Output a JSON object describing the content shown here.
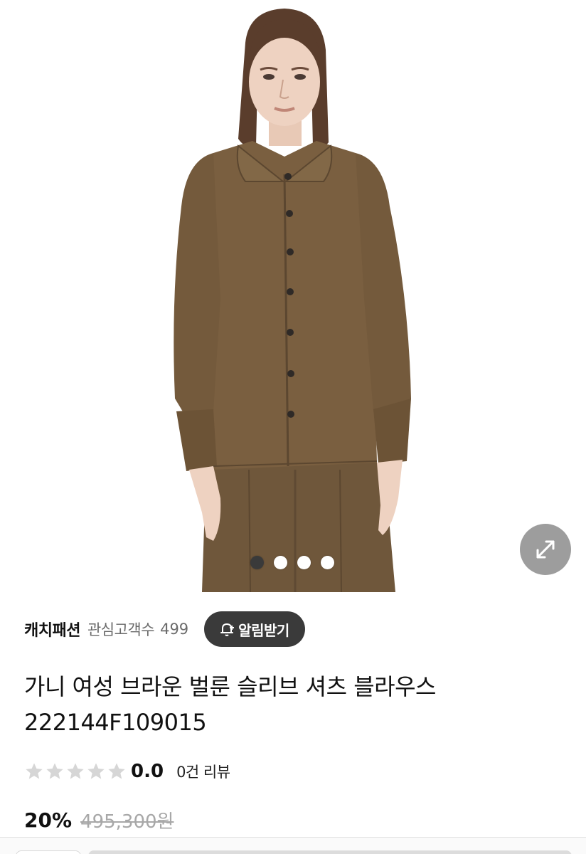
{
  "gallery": {
    "image_alt": "브라운 벌룬 슬리브 셔츠를 입은 모델",
    "current_index": 1,
    "total_images": 4,
    "zoom_icon": "expand-arrows-icon"
  },
  "seller": {
    "name": "캐치패션",
    "follower_label": "관심고객수",
    "follower_count": "499",
    "alert_button_label": "알림받기",
    "alert_icon": "bell-plus-icon"
  },
  "product": {
    "title": "가니 여성 브라운 벌룬 슬리브 셔츠 블라우스 222144F109015"
  },
  "rating": {
    "stars_filled": 0,
    "stars_total": 5,
    "score": "0.0",
    "review_count_label": "0건 리뷰"
  },
  "price": {
    "discount": "20%",
    "original_price": "495,300원"
  },
  "colors": {
    "shirt": "#7a5f40",
    "button_dark": "#3a3a3a",
    "star_empty": "#d6d6d6",
    "muted_text": "#6b6b6b"
  }
}
